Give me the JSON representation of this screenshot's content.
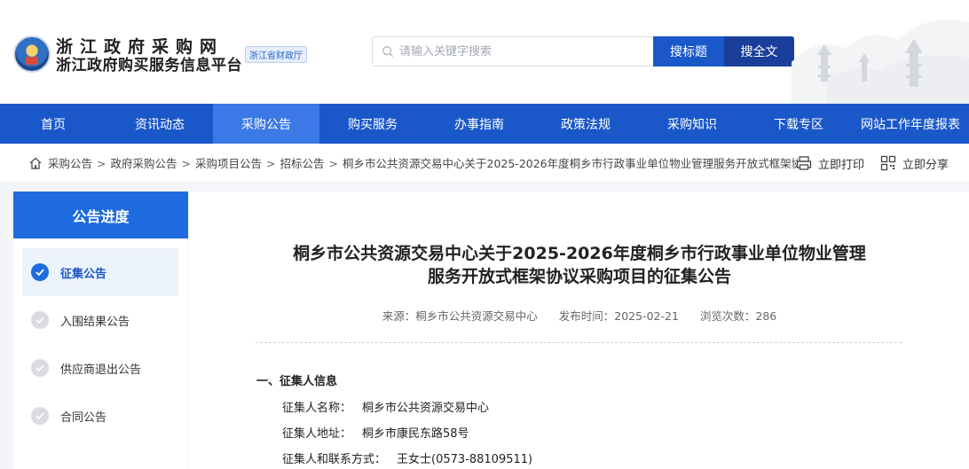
{
  "header": {
    "title_line1": "浙江政府采购网",
    "title_line2": "浙江政府购买服务信息平台",
    "badge": "浙江省财政厅"
  },
  "search": {
    "placeholder": "请输入关键字搜索",
    "btn_title": "搜标题",
    "btn_fulltext": "搜全文"
  },
  "nav": {
    "items": [
      "首页",
      "资讯动态",
      "采购公告",
      "购买服务",
      "办事指南",
      "政策法规",
      "采购知识",
      "下载专区",
      "网站工作年度报表"
    ],
    "active_index": 2
  },
  "breadcrumb": {
    "items": [
      "采购公告",
      "政府采购公告",
      "采购项目公告",
      "招标公告",
      "桐乡市公共资源交易中心关于2025-2026年度桐乡市行政事业单位物业管理服务开放式框架协"
    ],
    "separator": ">"
  },
  "tools": {
    "print": "立即打印",
    "share": "立即分享"
  },
  "sidebar": {
    "title": "公告进度",
    "steps": [
      {
        "label": "征集公告",
        "active": true
      },
      {
        "label": "入围结果公告",
        "active": false
      },
      {
        "label": "供应商退出公告",
        "active": false
      },
      {
        "label": "合同公告",
        "active": false
      }
    ]
  },
  "article": {
    "title_line1": "桐乡市公共资源交易中心关于2025-2026年度桐乡市行政事业单位物业管理",
    "title_line2": "服务开放式框架协议采购项目的征集公告",
    "source": "来源：桐乡市公共资源交易中心",
    "publish": "发布时间：2025-02-21",
    "views": "浏览次数：286",
    "section1": "一、征集人信息",
    "info": [
      {
        "key": "征集人名称：",
        "value": "桐乡市公共资源交易中心"
      },
      {
        "key": "征集人地址：",
        "value": "桐乡市康民东路58号"
      },
      {
        "key": "征集人和联系方式：",
        "value": "王女士(0573-88109511)"
      }
    ]
  },
  "colors": {
    "primary": "#1a58c9",
    "nav_active": "#3b7ae6",
    "sidebar_head": "#1f6ce0"
  }
}
